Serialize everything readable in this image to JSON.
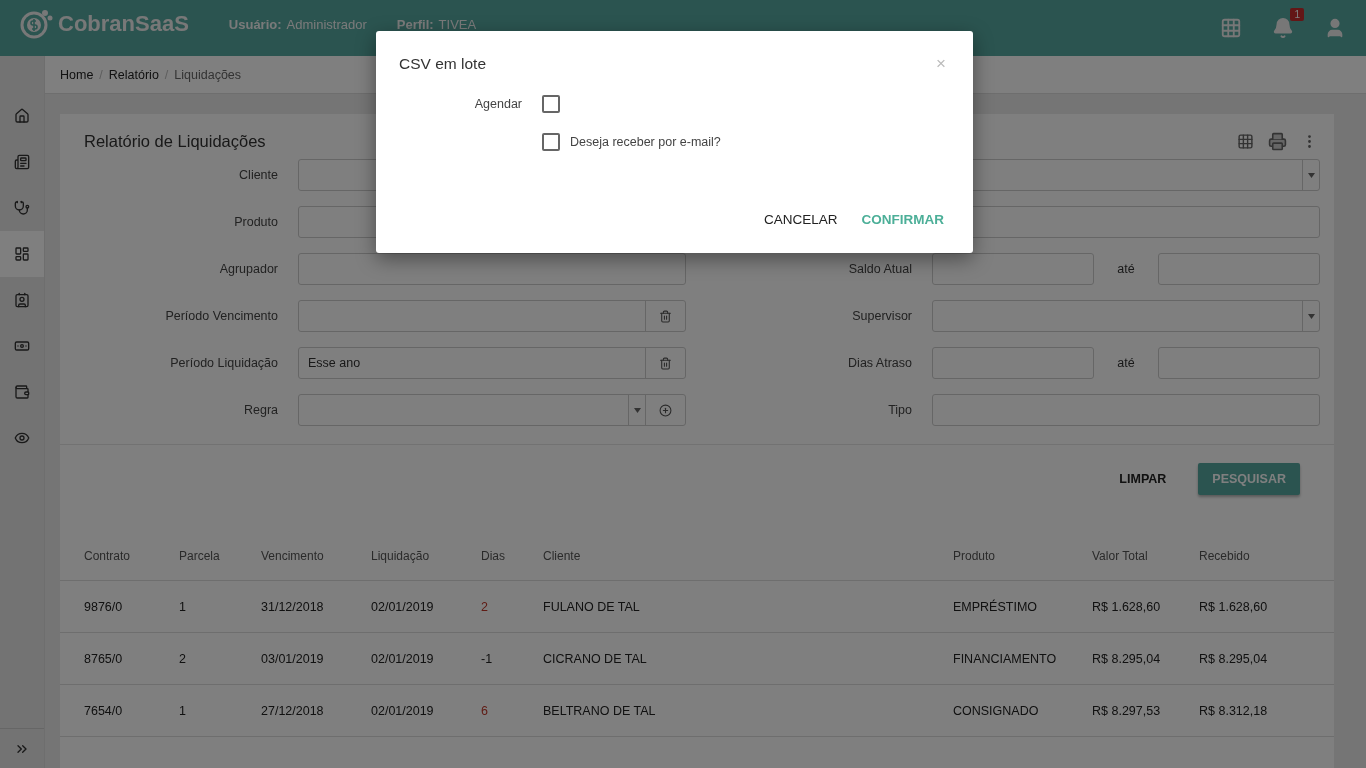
{
  "header": {
    "brand": "CobranSaaS",
    "user_label": "Usuário:",
    "user": "Administrador",
    "profile_label": "Perfil:",
    "profile": "TIVEA",
    "notification_count": "1"
  },
  "sidebar": {
    "items": [
      {
        "selected": false
      },
      {
        "selected": false
      },
      {
        "selected": false
      },
      {
        "selected": true
      },
      {
        "selected": false
      },
      {
        "selected": false
      },
      {
        "selected": false
      },
      {
        "selected": false
      }
    ]
  },
  "breadcrumb": [
    {
      "label": "Home",
      "current": false
    },
    {
      "label": "Relatório",
      "current": false
    },
    {
      "label": "Liquidações",
      "current": true
    }
  ],
  "breadcrumb_separator": "/",
  "report": {
    "title": "Relatório de Liquidações",
    "left_fields": [
      {
        "label": "Cliente",
        "kind": "text"
      },
      {
        "label": "Produto",
        "kind": "text"
      },
      {
        "label": "Agrupador",
        "kind": "text"
      },
      {
        "label": "Período Vencimento",
        "kind": "trash"
      },
      {
        "label": "Período Liquidação",
        "kind": "trash",
        "value": "Esse ano"
      },
      {
        "label": "Regra",
        "kind": "select-add"
      }
    ],
    "right_fields": [
      {
        "kind": "select"
      },
      {
        "kind": "text"
      },
      {
        "label": "Saldo Atual",
        "kind": "range",
        "between": "até"
      },
      {
        "label": "Supervisor",
        "kind": "select"
      },
      {
        "label": "Dias Atraso",
        "kind": "range",
        "between": "até"
      },
      {
        "label": "Tipo",
        "kind": "text"
      }
    ],
    "buttons": [
      {
        "label": "LIMPAR",
        "primary": false
      },
      {
        "label": "PESQUISAR",
        "primary": true
      }
    ]
  },
  "table": {
    "columns": [
      "Contrato",
      "Parcela",
      "Vencimento",
      "Liquidação",
      "Dias",
      "Cliente",
      "Produto",
      "Valor Total",
      "Recebido"
    ],
    "rows": [
      {
        "cells": [
          "9876/0",
          "1",
          "31/12/2018",
          "02/01/2019",
          "2",
          "FULANO DE TAL",
          "EMPRÉSTIMO",
          "R$ 1.628,60",
          "R$ 1.628,60"
        ],
        "late": true
      },
      {
        "cells": [
          "8765/0",
          "2",
          "03/01/2019",
          "02/01/2019",
          "-1",
          "CICRANO DE TAL",
          "FINANCIAMENTO",
          "R$ 8.295,04",
          "R$ 8.295,04"
        ],
        "late": false
      },
      {
        "cells": [
          "7654/0",
          "1",
          "27/12/2018",
          "02/01/2019",
          "6",
          "BELTRANO DE TAL",
          "CONSIGNADO",
          "R$ 8.297,53",
          "R$ 8.312,18"
        ],
        "late": true
      }
    ]
  },
  "dialog": {
    "title": "CSV em lote",
    "close": "×",
    "schedule_label": "Agendar",
    "schedule_checked": false,
    "email_label": "Deseja receber por e-mail?",
    "email_checked": false,
    "buttons": [
      {
        "label": "CANCELAR",
        "primary": false
      },
      {
        "label": "CONFIRMAR",
        "primary": true
      }
    ]
  }
}
